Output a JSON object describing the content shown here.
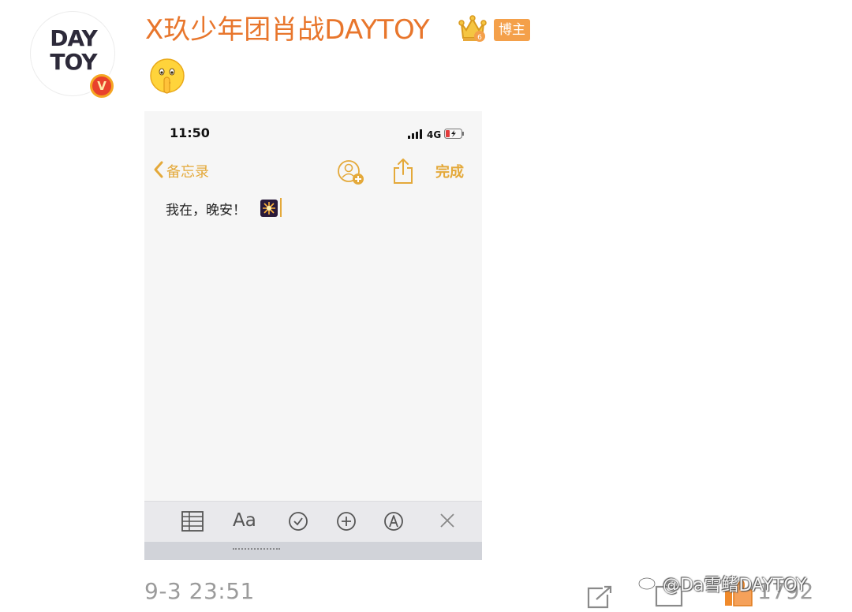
{
  "post": {
    "avatar": {
      "logo_line1": "DAY",
      "logo_line2": "TOY",
      "verified_mark": "V"
    },
    "username": "X玖少年团肖战DAYTOY",
    "crown_icon": "crown-icon",
    "blogger_badge": "博主",
    "emoji": "shushing-face-emoji",
    "timestamp": "9-3 23:51",
    "like_count": "1792"
  },
  "screenshot": {
    "status_bar": {
      "time": "11:50",
      "network": "4G"
    },
    "nav": {
      "back_label": "备忘录",
      "done_label": "完成"
    },
    "note": {
      "text": "我在，晚安！",
      "emoji": "fireworks-emoji"
    },
    "toolbar": {
      "font_label": "Aa"
    }
  },
  "watermark": {
    "text": "@Da雪鳍DAYTOY"
  },
  "colors": {
    "username": "#e8762c",
    "badge": "#f4a04a",
    "ios_accent": "#e4a93a",
    "timestamp": "#9b9b9b"
  }
}
